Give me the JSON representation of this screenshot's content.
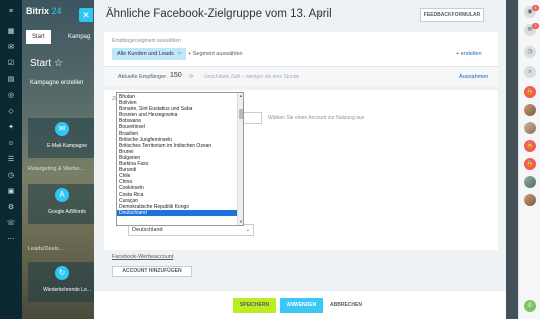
{
  "app": {
    "brand": "Bitrix",
    "brand_num": "24"
  },
  "background": {
    "tabs": [
      "Start",
      "Kampag"
    ],
    "start_title": "Start",
    "subtitle": "Kampagne erstellen",
    "tiles": [
      "E-Mail-Kampagne",
      "Google AdWords",
      "Wiederkehrende Le..."
    ],
    "section1": "Retargeting & Werbe...",
    "section2": "Leads/Deals..."
  },
  "panel": {
    "title": "Ähnliche Facebook-Zielgruppe vom 13. April",
    "feedback_label": "FEEDBACKFORMULAR",
    "segment_label": "Empfängersegment auswählen",
    "chip_label": "Alle Kunden und Leads",
    "chip_close": "×",
    "add_segment": "+ Segment auswählen",
    "create": "+ erstellen",
    "recipients_label": "Aktuelle Empfänger:",
    "recipients_value": "150",
    "recipients_hint": "Geschätzte Zahl – weniger als eine Stunde",
    "recipients_link": "Ausnahmen",
    "section_label": "Zie",
    "account_select": "",
    "account_note": "Wählen Sie einen Account zur Nutzung aus",
    "country_value": "Deutschland",
    "fb_link": "Facebook-Werbeaccount",
    "add_account_label": "ACCOUNT HINZUFÜGEN"
  },
  "footer": {
    "save": "SPEICHERN",
    "apply": "ANWENDEN",
    "cancel": "ABBRECHEN"
  },
  "dropdown": {
    "items": [
      "Bhutan",
      "Bolivien",
      "Bonaire, Sint Eustatius und Saba",
      "Bosnien und Herzegowina",
      "Botswana",
      "Bouvetinsel",
      "Brasilien",
      "Britische Jungferninseln",
      "Britisches Territorium im Indischen Ozean",
      "Brunei",
      "Bulgarien",
      "Burkina Faso",
      "Burundi",
      "Chile",
      "China",
      "Cookinseln",
      "Costa Rica",
      "Curaçao",
      "Demokratische Republik Kongo",
      "Deutschland"
    ],
    "selected_index": 19
  },
  "right_bar": {
    "badge_1": "4",
    "badge_2": "2"
  },
  "colors": {
    "accent": "#2fc6f6",
    "save": "#bbed21",
    "apply": "#3bc8f5",
    "selection": "#1e73d8"
  }
}
